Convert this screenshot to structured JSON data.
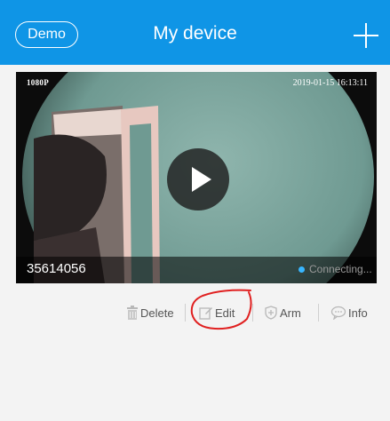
{
  "header": {
    "demo_label": "Demo",
    "title": "My device",
    "add_icon": "plus-icon"
  },
  "device": {
    "resolution": "1080P",
    "timestamp": "2019-01-15  16:13:11",
    "id": "35614056",
    "status": "Connecting...",
    "play_icon": "play-icon"
  },
  "actions": [
    {
      "label": "Delete",
      "icon": "trash-icon"
    },
    {
      "label": "Edit",
      "icon": "edit-icon"
    },
    {
      "label": "Arm",
      "icon": "shield-icon"
    },
    {
      "label": "Info",
      "icon": "chat-icon"
    }
  ],
  "colors": {
    "header_bg": "#0f95e6",
    "status_dot": "#38b6ff",
    "annotation": "#e02020"
  }
}
